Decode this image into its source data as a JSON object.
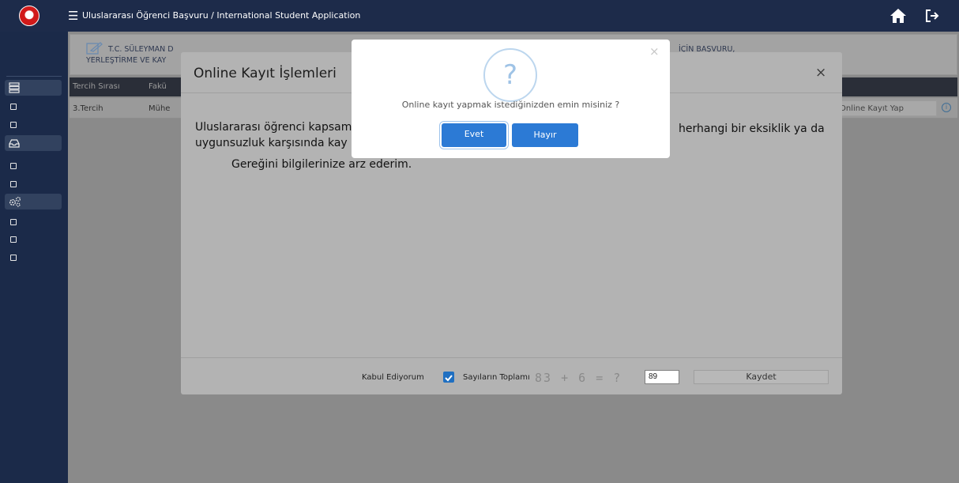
{
  "topbar": {
    "title": "Uluslararası Öğrenci Başvuru / International Student Application",
    "menu_icon": "☰",
    "icons": [
      "menu-icon",
      "home-icon",
      "logout-icon"
    ]
  },
  "sidebar": {
    "items": [
      {
        "icon": "list-grid-icon",
        "active": true
      },
      {
        "icon": "square-icon",
        "active": false
      },
      {
        "icon": "square-icon",
        "active": false
      },
      {
        "icon": "inbox-icon",
        "active": true
      },
      {
        "icon": "square-icon",
        "active": false
      },
      {
        "icon": "square-icon",
        "active": false
      },
      {
        "icon": "cogs-icon",
        "active": true
      },
      {
        "icon": "square-icon",
        "active": false
      },
      {
        "icon": "square-icon",
        "active": false
      },
      {
        "icon": "square-icon",
        "active": false
      }
    ]
  },
  "page": {
    "header_line1": "T.C. SÜLEYMAN D",
    "header_line2": "YERLEŞTİRME VE KAY",
    "header_right": "İÇİN BAŞVURU,",
    "table_headers": [
      "Tercih Sırası",
      "Fakü"
    ],
    "row": {
      "col1": "3.Tercih",
      "col2": "Mühe",
      "action": "Online Kayıt Yap"
    }
  },
  "modal": {
    "title": "Online Kayıt İşlemleri",
    "close": "×",
    "body_line1_start": "Uluslararası öğrenci kapsam",
    "body_line1_end": "herhangi bir eksiklik ya da",
    "body_line2": "uygunsuzluk karşısında kay",
    "body_line3": "Gereğini bilgilerinize arz ederim.",
    "accept_label": "Kabul Ediyorum",
    "sum_label": "Sayıların Toplamı",
    "captcha_text": "83 + 6 = ?",
    "captcha_answer": "89",
    "save_label": "Kaydet"
  },
  "confirm": {
    "message": "Online kayıt yapmak istediğinizden emin misiniz ?",
    "icon_text": "?",
    "yes_label": "Evet",
    "no_label": "Hayır",
    "close": "×"
  },
  "colors": {
    "topbar": "#1d2b4a",
    "accent": "#2c7ad5"
  }
}
